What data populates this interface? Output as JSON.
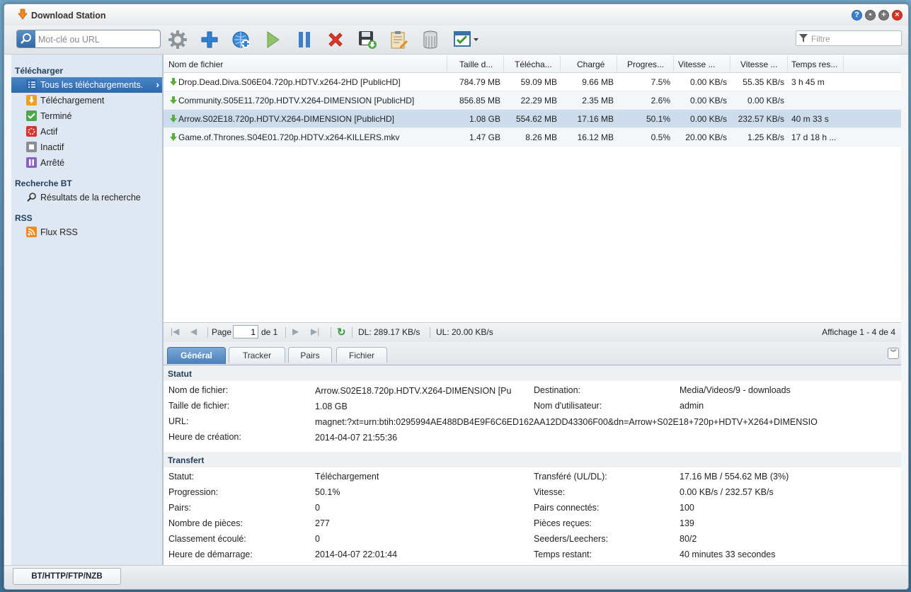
{
  "app": {
    "title": "Download Station"
  },
  "toolbar": {
    "search_placeholder": "Mot-clé ou URL",
    "filter_placeholder": "Filtre"
  },
  "sidebar": {
    "sections": [
      {
        "title": "Télécharger"
      },
      {
        "title": "Recherche BT"
      },
      {
        "title": "RSS"
      }
    ],
    "items": [
      {
        "label": "Tous les téléchargements.",
        "icon": "list-icon"
      },
      {
        "label": "Téléchargement",
        "icon": "download-icon"
      },
      {
        "label": "Terminé",
        "icon": "check-icon"
      },
      {
        "label": "Actif",
        "icon": "active-icon"
      },
      {
        "label": "Inactif",
        "icon": "inactive-icon"
      },
      {
        "label": "Arrêté",
        "icon": "pause-icon"
      },
      {
        "label": "Résultats de la recherche",
        "icon": "search-icon"
      },
      {
        "label": "Flux RSS",
        "icon": "rss-icon"
      }
    ]
  },
  "grid": {
    "columns": [
      "Nom de fichier",
      "Taille d...",
      "Télécha...",
      "Chargé",
      "Progres...",
      "Vitesse ...",
      "Vitesse ...",
      "Temps res..."
    ],
    "rows": [
      {
        "name": "Drop.Dead.Diva.S06E04.720p.HDTV.x264-2HD [PublicHD]",
        "size": "784.79 MB",
        "downloaded": "59.09 MB",
        "uploaded": "9.66 MB",
        "progress": "7.5%",
        "ul_speed": "0.00 KB/s",
        "dl_speed": "55.35 KB/s",
        "remaining": "3 h 45 m"
      },
      {
        "name": "Community.S05E11.720p.HDTV.X264-DIMENSION [PublicHD]",
        "size": "856.85 MB",
        "downloaded": "22.29 MB",
        "uploaded": "2.35 MB",
        "progress": "2.6%",
        "ul_speed": "0.00 KB/s",
        "dl_speed": "0.00 KB/s",
        "remaining": ""
      },
      {
        "name": "Arrow.S02E18.720p.HDTV.X264-DIMENSION [PublicHD]",
        "size": "1.08 GB",
        "downloaded": "554.62 MB",
        "uploaded": "17.16 MB",
        "progress": "50.1%",
        "ul_speed": "0.00 KB/s",
        "dl_speed": "232.57 KB/s",
        "remaining": "40 m 33 s"
      },
      {
        "name": "Game.of.Thrones.S04E01.720p.HDTV.x264-KILLERS.mkv",
        "size": "1.47 GB",
        "downloaded": "8.26 MB",
        "uploaded": "16.12 MB",
        "progress": "0.5%",
        "ul_speed": "20.00 KB/s",
        "dl_speed": "1.25 KB/s",
        "remaining": "17 d 18 h ..."
      }
    ]
  },
  "pager": {
    "page_label": "Page",
    "page_value": "1",
    "of_label": "de 1",
    "dl": "DL: 289.17 KB/s",
    "ul": "UL: 20.00 KB/s",
    "display": "Affichage 1 - 4 de 4"
  },
  "detail": {
    "tabs": [
      "Général",
      "Tracker",
      "Pairs",
      "Fichier"
    ],
    "status_section": "Statut",
    "transfer_section": "Transfert",
    "status_fields": [
      {
        "label": "Nom de fichier:",
        "value": "Arrow.S02E18.720p.HDTV.X264-DIMENSION [Pu"
      },
      {
        "label": "Taille de fichier:",
        "value": "1.08 GB"
      },
      {
        "label": "URL:",
        "value": "magnet:?xt=urn:btih:0295994AE488DB4E9F6C6ED162AA12DD43306F00&dn=Arrow+S02E18+720p+HDTV+X264+DIMENSIO"
      },
      {
        "label": "Heure de création:",
        "value": "2014-04-07 21:55:36"
      }
    ],
    "status_fields_right": [
      {
        "label": "Destination:",
        "value": "Media/Videos/9 - downloads"
      },
      {
        "label": "Nom d'utilisateur:",
        "value": "admin"
      }
    ],
    "transfer_left": [
      {
        "label": "Statut:",
        "value": "Téléchargement"
      },
      {
        "label": "Progression:",
        "value": "50.1%"
      },
      {
        "label": "Pairs:",
        "value": "0"
      },
      {
        "label": "Nombre de pièces:",
        "value": "277"
      },
      {
        "label": "Classement écoulé:",
        "value": "0"
      },
      {
        "label": "Heure de démarrage:",
        "value": "2014-04-07 22:01:44"
      }
    ],
    "transfer_right": [
      {
        "label": "Transféré (UL/DL):",
        "value": "17.16 MB / 554.62 MB (3%)"
      },
      {
        "label": "Vitesse:",
        "value": "0.00 KB/s / 232.57 KB/s"
      },
      {
        "label": "Pairs connectés:",
        "value": "100"
      },
      {
        "label": "Pièces reçues:",
        "value": "139"
      },
      {
        "label": "Seeders/Leechers:",
        "value": "80/2"
      },
      {
        "label": "Temps restant:",
        "value": "40 minutes 33 secondes"
      }
    ]
  },
  "statusbar": {
    "protocol_tab": "BT/HTTP/FTP/NZB"
  }
}
